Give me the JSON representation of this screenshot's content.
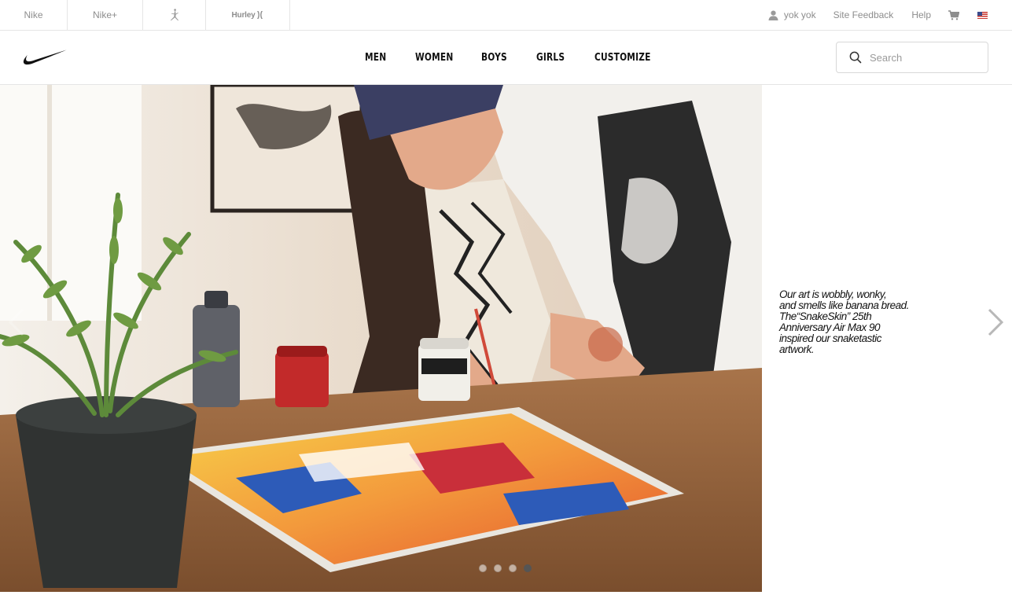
{
  "utility_bar": {
    "brand_tabs": [
      {
        "label": "Nike"
      },
      {
        "label": "Nike+"
      },
      {
        "label": ""
      },
      {
        "label": "Hurley"
      }
    ],
    "user_name": "yok yok",
    "site_feedback": "Site Feedback",
    "help": "Help",
    "region_icon": "us-flag-icon"
  },
  "header": {
    "nav": [
      "MEN",
      "WOMEN",
      "BOYS",
      "GIRLS",
      "CUSTOMIZE"
    ],
    "search_placeholder": "Search"
  },
  "hero": {
    "caption_lines": [
      "Our art is wobbly, wonky,",
      "and smells like banana bread.",
      "The“SnakeSkin” 25th",
      "Anniversary Air Max 90",
      "inspired our snaketastic",
      "artwork."
    ],
    "slides_total": 4,
    "active_slide": 4
  },
  "colors": {
    "accent_text": "#111111",
    "muted_text": "#8d8d8d",
    "border": "#e5e5e5"
  }
}
